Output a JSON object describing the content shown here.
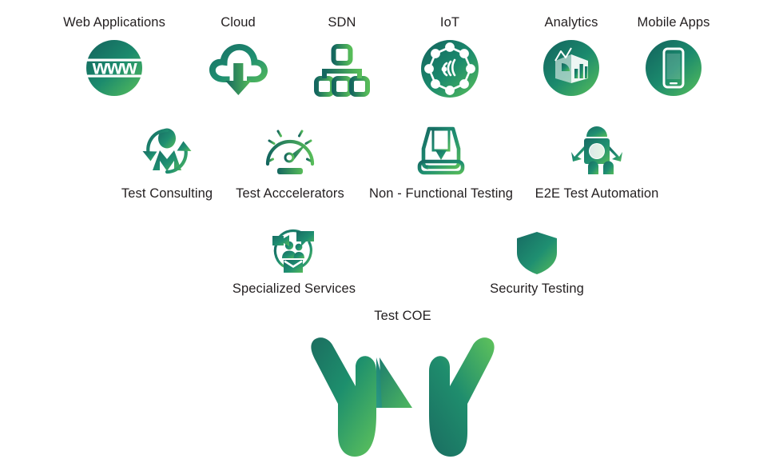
{
  "diagram": {
    "title": "Test COE services diagram",
    "colors": {
      "dark_teal": "#176b63",
      "deep_green": "#14726a",
      "mid_green": "#1f9b6e",
      "bright_green": "#4cb council",
      "accent_green": "#48b255",
      "text": "#231f20",
      "background": "#ffffff"
    },
    "rows": {
      "technologies": [
        {
          "id": "web-applications",
          "label": "Web Applications",
          "icon": "globe-www-icon"
        },
        {
          "id": "cloud",
          "label": "Cloud",
          "icon": "cloud-download-icon"
        },
        {
          "id": "sdn",
          "label": "SDN",
          "icon": "network-hierarchy-icon"
        },
        {
          "id": "iot",
          "label": "IoT",
          "icon": "iot-network-circle-icon"
        },
        {
          "id": "analytics",
          "label": "Analytics",
          "icon": "analytics-charts-circle-icon"
        },
        {
          "id": "mobile-apps",
          "label": "Mobile Apps",
          "icon": "smartphone-circle-icon"
        }
      ],
      "services": [
        {
          "id": "test-consulting",
          "label": "Test Consulting",
          "icon": "person-refresh-icon"
        },
        {
          "id": "test-accelerators",
          "label": "Test Acccelerators",
          "icon": "speedometer-icon"
        },
        {
          "id": "non-functional-testing",
          "label": "Non - Functional Testing",
          "icon": "document-load-tray-icon"
        },
        {
          "id": "e2e-test-automation",
          "label": "E2E Test Automation",
          "icon": "robot-icon"
        }
      ],
      "specialties": [
        {
          "id": "specialized-services",
          "label": "Specialized Services",
          "icon": "people-communication-icon"
        },
        {
          "id": "security-testing",
          "label": "Security Testing",
          "icon": "shield-icon"
        }
      ]
    },
    "center": {
      "id": "test-coe",
      "label": "Test COE",
      "icon": "hands-holding-pyramid-icon"
    }
  }
}
